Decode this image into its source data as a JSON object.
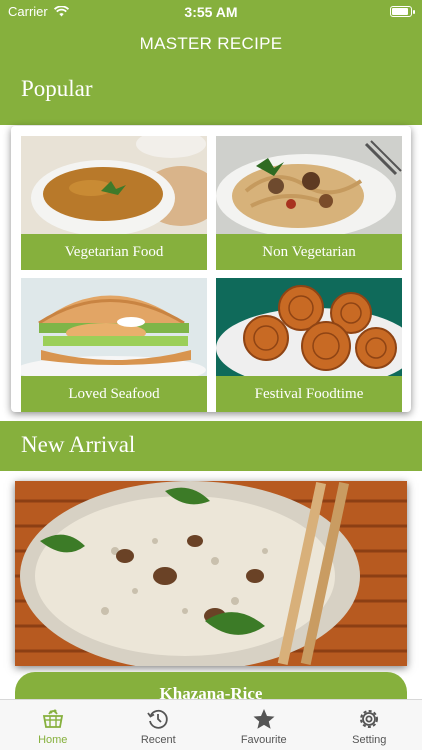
{
  "status_bar": {
    "carrier": "Carrier",
    "time": "3:55 AM"
  },
  "header": {
    "title": "MASTER RECIPE"
  },
  "popular": {
    "title": "Popular",
    "items": [
      {
        "label": "Vegetarian Food"
      },
      {
        "label": "Non Vegetarian"
      },
      {
        "label": "Loved Seafood"
      },
      {
        "label": "Festival Foodtime"
      }
    ]
  },
  "new_arrival": {
    "title": "New Arrival",
    "item": {
      "label": "Khazana-Rice"
    }
  },
  "tabs": [
    {
      "label": "Home",
      "icon": "home-basket-icon",
      "active": true
    },
    {
      "label": "Recent",
      "icon": "history-icon",
      "active": false
    },
    {
      "label": "Favourite",
      "icon": "star-icon",
      "active": false
    },
    {
      "label": "Setting",
      "icon": "gear-icon",
      "active": false
    }
  ],
  "colors": {
    "accent": "#86b03d",
    "tab_inactive": "#555555"
  }
}
